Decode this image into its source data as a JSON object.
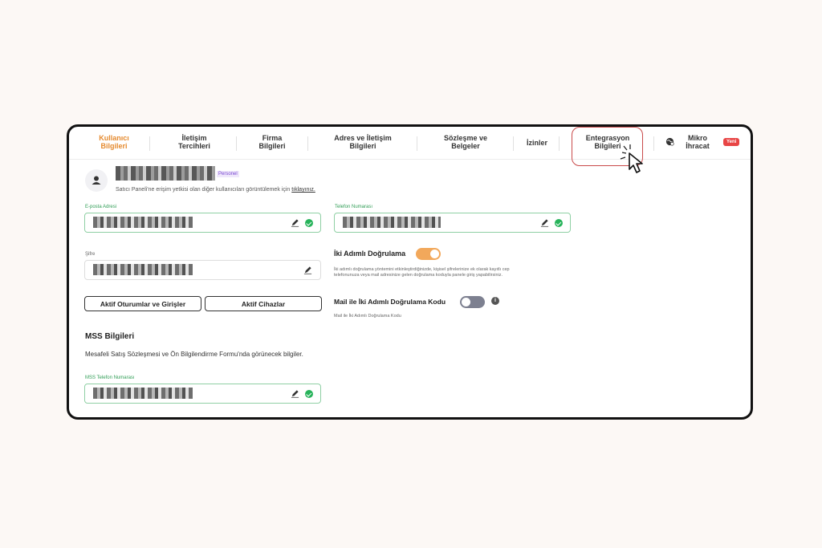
{
  "tabs": [
    {
      "line1": "Kullanıcı",
      "line2": "Bilgileri",
      "active": true
    },
    {
      "line1": "İletişim",
      "line2": "Tercihleri"
    },
    {
      "line1": "Firma",
      "line2": "Bilgileri"
    },
    {
      "line1": "Adres ve İletişim",
      "line2": "Bilgileri"
    },
    {
      "line1": "Sözleşme ve",
      "line2": "Belgeler"
    },
    {
      "line1": "İzinler",
      "line2": ""
    },
    {
      "line1": "Entegrasyon",
      "line2": "Bilgileri"
    },
    {
      "line1": "Mikro",
      "line2": "İhracat"
    }
  ],
  "new_badge": "Yeni",
  "user": {
    "role_badge": "Personel",
    "description": "Satıcı Paneli'ne erişim yetkisi olan diğer kullanıcıları görüntülemek için",
    "description_link": "tıklayınız."
  },
  "fields": {
    "email_label": "E-posta Adresi",
    "phone_label": "Telefon Numarası",
    "password_label": "Şifre",
    "mss_phone_label": "MSS Telefon Numarası"
  },
  "two_factor": {
    "title": "İki Adımlı Doğrulama",
    "enabled": true,
    "description_line1": "İki adımlı doğrulama yöntemini etkinleştirdiğinizde, kişisel şifrelerinize ek olarak kayıtlı cep",
    "description_line2": "telefonunuza veya mail adresinize gelen doğrulama koduyla panele giriş yapabilirsiniz."
  },
  "mail_two_factor": {
    "title": "Mail ile İki Adımlı Doğrulama Kodu",
    "enabled": false,
    "subtitle": "Mail ile İki Adımlı Doğrulama Kodu"
  },
  "buttons": {
    "sessions": "Aktif Oturumlar ve Girişler",
    "devices": "Aktif Cihazlar"
  },
  "mss": {
    "title": "MSS Bilgileri",
    "description": "Mesafeli Satış Sözleşmesi ve Ön Bilgilendirme Formu'nda görünecek bilgiler."
  },
  "colors": {
    "accent": "#e58a2e",
    "success": "#27b35a",
    "highlight": "#c94a4a"
  }
}
